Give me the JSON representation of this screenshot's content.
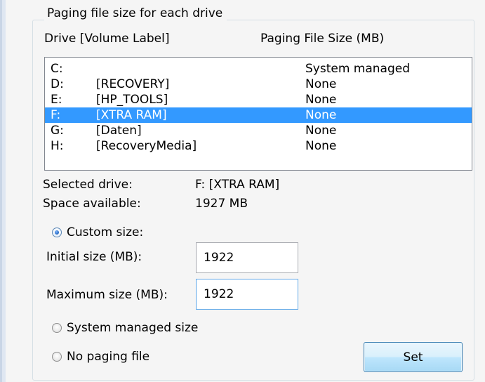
{
  "group": {
    "title": "Paging file size for each drive",
    "col_drive": "Drive  [Volume Label]",
    "col_size": "Paging File Size (MB)"
  },
  "drives": [
    {
      "drive": "C:",
      "label": "",
      "size": "System managed",
      "selected": false
    },
    {
      "drive": "D:",
      "label": "[RECOVERY]",
      "size": "None",
      "selected": false
    },
    {
      "drive": "E:",
      "label": "[HP_TOOLS]",
      "size": "None",
      "selected": false
    },
    {
      "drive": "F:",
      "label": "[XTRA RAM]",
      "size": "None",
      "selected": true
    },
    {
      "drive": "G:",
      "label": "[Daten]",
      "size": "None",
      "selected": false
    },
    {
      "drive": "H:",
      "label": "[RecoveryMedia]",
      "size": "None",
      "selected": false
    }
  ],
  "info": {
    "selected_drive_label": "Selected drive:",
    "selected_drive_value": "F:  [XTRA RAM]",
    "space_available_label": "Space available:",
    "space_available_value": "1927 MB"
  },
  "options": {
    "custom_size_label": "Custom size:",
    "initial_size_label": "Initial size (MB):",
    "initial_size_value": "1922",
    "maximum_size_label": "Maximum size (MB):",
    "maximum_size_value": "1922",
    "system_managed_label": "System managed size",
    "no_paging_label": "No paging file",
    "selected_option": "custom"
  },
  "buttons": {
    "set_label": "Set"
  },
  "colors": {
    "selection": "#3399ff",
    "dialog_bg": "#f5f5f5"
  }
}
